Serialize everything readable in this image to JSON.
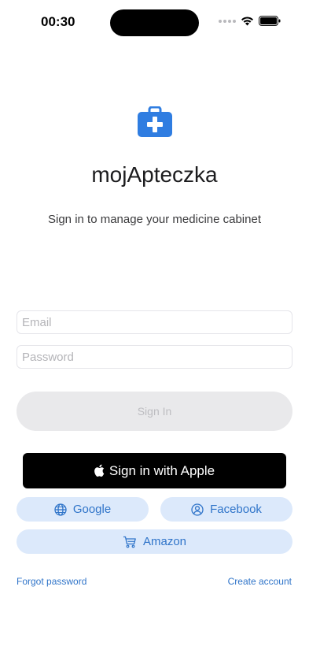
{
  "status_bar": {
    "time": "00:30"
  },
  "app": {
    "title": "mojApteczka",
    "subtitle": "Sign in to manage your medicine cabinet",
    "icon": "medical-kit-icon",
    "accent_color": "#2f7de1"
  },
  "form": {
    "email_placeholder": "Email",
    "password_placeholder": "Password",
    "signin_label": "Sign In"
  },
  "social": {
    "apple_label": "Sign in with Apple",
    "google_label": "Google",
    "facebook_label": "Facebook",
    "amazon_label": "Amazon",
    "button_bg": "#dce9fb",
    "button_text_color": "#2f74c9"
  },
  "links": {
    "forgot_password": "Forgot password",
    "create_account": "Create account"
  }
}
